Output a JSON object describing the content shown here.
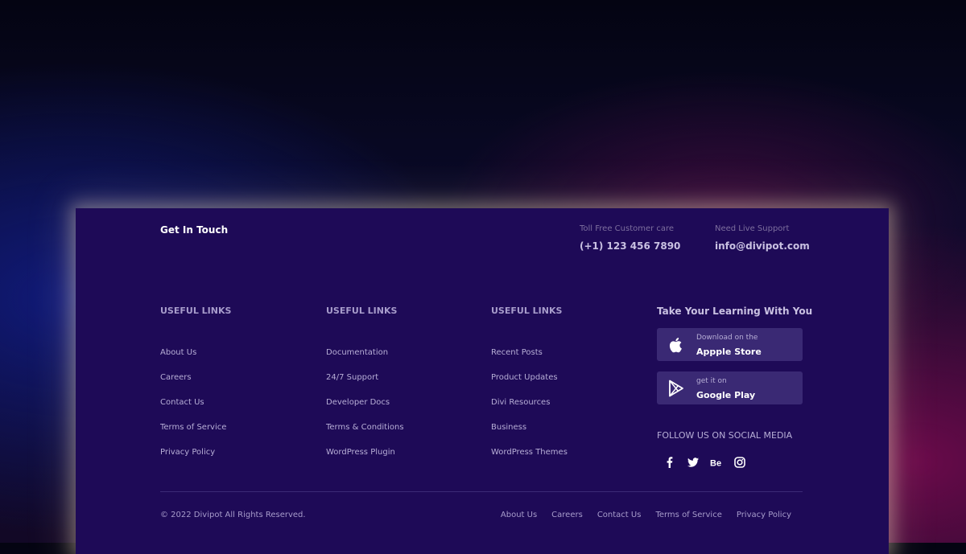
{
  "header": {
    "title": "Get In Touch",
    "toll_free_label": "Toll Free Customer care",
    "phone": "(+1) 123 456 7890",
    "support_label": "Need Live Support",
    "email": "info@divipot.com"
  },
  "columns": [
    {
      "title": "USEFUL LINKS",
      "links": [
        "About Us",
        "Careers",
        "Contact Us",
        "Terms of Service",
        "Privacy Policy"
      ]
    },
    {
      "title": "USEFUL LINKS",
      "links": [
        "Documentation",
        "24/7 Support",
        "Developer Docs",
        "Terms & Conditions",
        "WordPress Plugin"
      ]
    },
    {
      "title": "USEFUL LINKS",
      "links": [
        "Recent Posts",
        "Product Updates",
        "Divi Resources",
        "Business",
        "WordPress Themes"
      ]
    }
  ],
  "apps": {
    "title": "Take Your Learning With You",
    "apple": {
      "small": "Download on the",
      "big": "Appple Store",
      "icon": "apple-icon"
    },
    "google": {
      "small": "get it on",
      "big": "Google Play",
      "icon": "play-icon"
    }
  },
  "social": {
    "title": "FOLLOW US ON SOCIAL MEDIA",
    "icons": [
      "facebook-icon",
      "twitter-icon",
      "behance-icon",
      "instagram-icon"
    ]
  },
  "bottom": {
    "copyright": "© 2022 Divipot All Rights Reserved.",
    "links": [
      "About Us",
      "Careers",
      "Contact Us",
      "Terms of Service",
      "Privacy Policy"
    ]
  },
  "colors": {
    "footer_bg": "#1e0a57",
    "button_bg": "#3a2974",
    "text_muted": "#a79ccb",
    "text_white": "#ffffff"
  }
}
